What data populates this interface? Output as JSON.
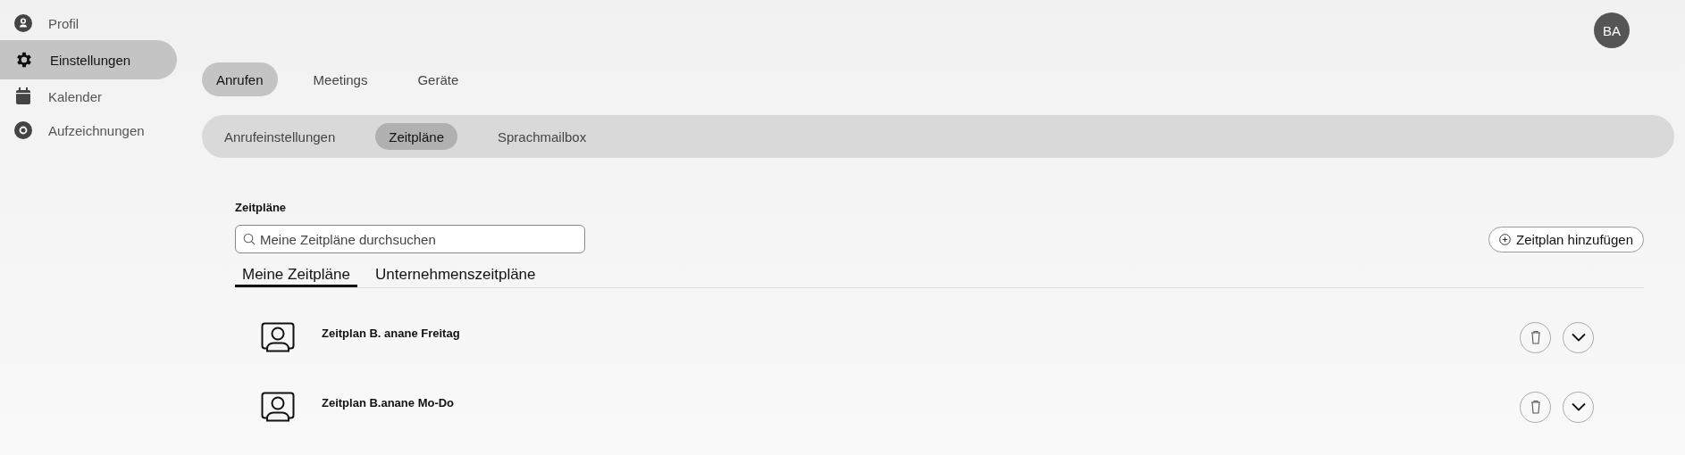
{
  "sidebar": {
    "items": [
      {
        "label": "Profil",
        "selected": false
      },
      {
        "label": "Einstellungen",
        "selected": true
      },
      {
        "label": "Kalender",
        "selected": false
      },
      {
        "label": "Aufzeichnungen",
        "selected": false
      }
    ]
  },
  "avatar": {
    "initials": "BA"
  },
  "tabs": [
    {
      "label": "Anrufen",
      "selected": true
    },
    {
      "label": "Meetings",
      "selected": false
    },
    {
      "label": "Geräte",
      "selected": false
    }
  ],
  "subtabs": [
    {
      "label": "Anrufeinstellungen",
      "selected": false
    },
    {
      "label": "Zeitpläne",
      "selected": true
    },
    {
      "label": "Sprachmailbox",
      "selected": false
    }
  ],
  "section": {
    "title": "Zeitpläne",
    "search": {
      "placeholder": "Meine Zeitpläne durchsuchen"
    },
    "add_button": "Zeitplan hinzufügen",
    "tabs": [
      {
        "label": "Meine Zeitpläne",
        "selected": true
      },
      {
        "label": "Unternehmenszeitpläne",
        "selected": false
      }
    ],
    "schedules": [
      {
        "name": "Zeitplan B. anane Freitag"
      },
      {
        "name": "Zeitplan B.anane Mo-Do"
      }
    ]
  }
}
